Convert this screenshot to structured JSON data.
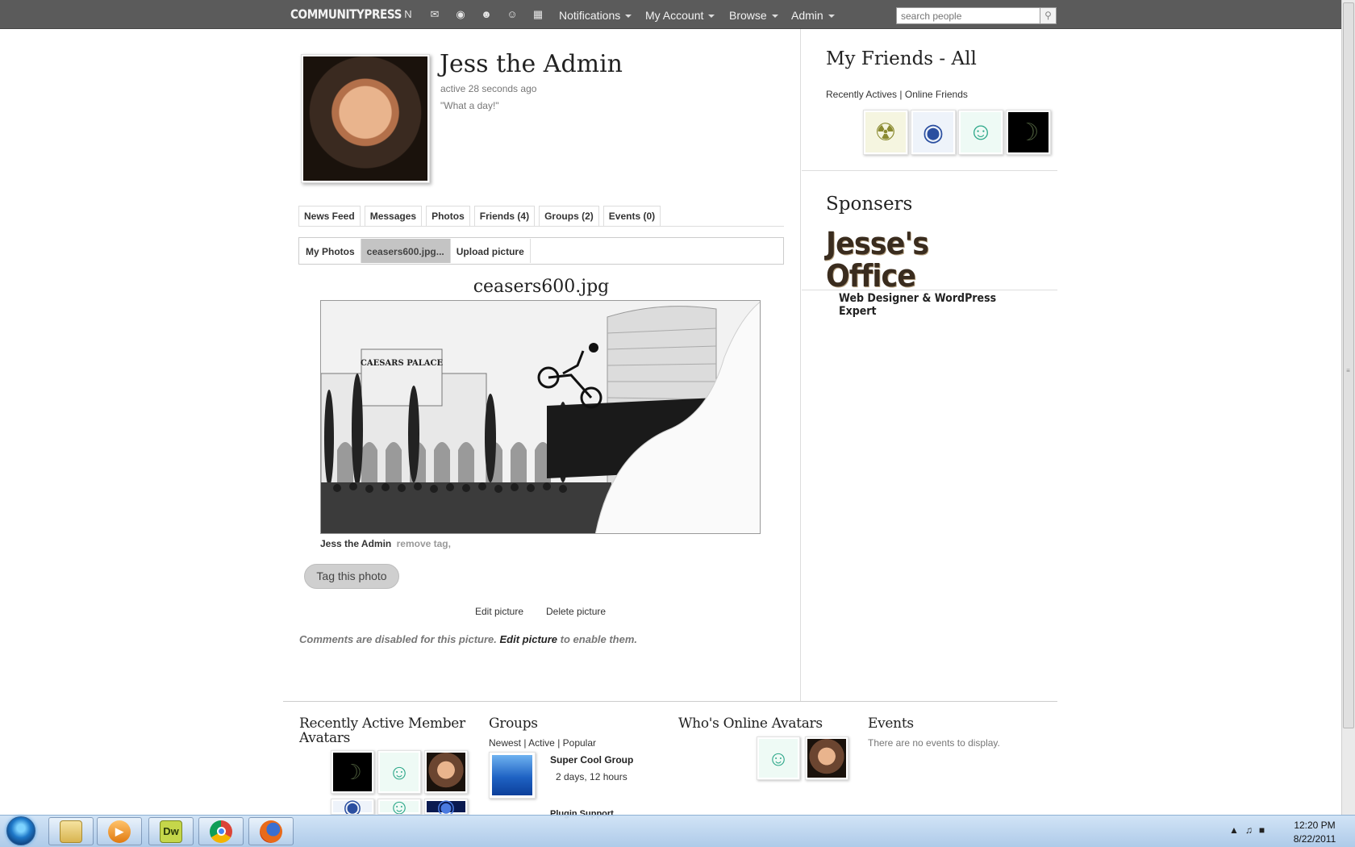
{
  "topbar": {
    "logo": "COMMUNITYPRESS",
    "icons": [
      "news-icon",
      "messages-icon",
      "photos-icon",
      "profile-icon",
      "friends-icon",
      "events-icon"
    ],
    "menus": [
      "Notifications",
      "My Account",
      "Browse",
      "Admin"
    ],
    "search_placeholder": "search people"
  },
  "profile": {
    "name": "Jess the Admin",
    "active": "active 28 seconds ago",
    "status": "\"What a day!\""
  },
  "tabs": [
    "News Feed",
    "Messages",
    "Photos",
    "Friends (4)",
    "Groups (2)",
    "Events (0)"
  ],
  "subtabs": [
    "My Photos",
    "ceasers600.jpg...",
    "Upload picture"
  ],
  "photo": {
    "title": "ceasers600.jpg",
    "sign_text": "CAESARS PALACE",
    "tag_name": "Jess the Admin",
    "tag_remove": "remove tag,",
    "tag_button": "Tag this photo",
    "edit": "Edit picture",
    "delete": "Delete picture",
    "comments_before": "Comments are disabled for this picture.",
    "comments_link": "Edit picture",
    "comments_after": "to enable them."
  },
  "sidebar": {
    "friends_title": "My Friends - All",
    "friends_link_recent": "Recently Actives",
    "friends_link_sep": "|",
    "friends_link_online": "Online Friends",
    "sponsors_title": "Sponsers",
    "sponsor_main": "Jesse's Office",
    "sponsor_sub": "Web Designer & WordPress Expert"
  },
  "footer": {
    "recent_title": "Recently Active Member Avatars",
    "groups_title": "Groups",
    "groups_filter_newest": "Newest",
    "groups_filter_active": "Active",
    "groups_filter_popular": "Popular",
    "groups_filter_sep": "|",
    "group_name": "Super Cool Group",
    "group_time": "2 days, 12 hours",
    "group2_name": "Plugin Support",
    "online_title": "Who's Online Avatars",
    "events_title": "Events",
    "events_empty": "There are no events to display."
  },
  "taskbar": {
    "apps": [
      "explorer",
      "media-player",
      "dreamweaver",
      "chrome",
      "firefox"
    ],
    "dreamweaver_label": "Dw",
    "time": "12:20 PM",
    "date": "8/22/2011"
  },
  "colors": {
    "topbar": "#5b5b5b",
    "active_subtab": "#c4c4c4",
    "taskbar": "#aac8e8"
  }
}
